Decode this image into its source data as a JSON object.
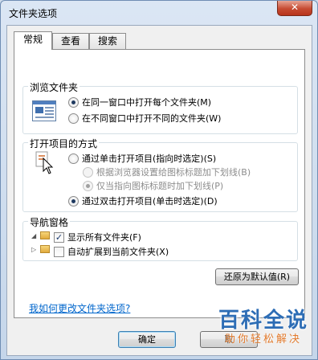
{
  "window": {
    "title": "文件夹选项",
    "close_label": "✕"
  },
  "tabs": [
    {
      "label": "常规",
      "active": true
    },
    {
      "label": "查看",
      "active": false
    },
    {
      "label": "搜索",
      "active": false
    }
  ],
  "browse_group": {
    "title": "浏览文件夹",
    "options": [
      {
        "label": "在同一窗口中打开每个文件夹(M)",
        "checked": true
      },
      {
        "label": "在不同窗口中打开不同的文件夹(W)",
        "checked": false
      }
    ]
  },
  "click_group": {
    "title": "打开项目的方式",
    "single_click": {
      "label": "通过单击打开项目(指向时选定)(S)",
      "checked": false
    },
    "underline_consistent": {
      "label": "根据浏览器设置给图标标题加下划线(B)",
      "checked": false
    },
    "underline_point": {
      "label": "仅当指向图标标题时加下划线(P)",
      "checked": true
    },
    "double_click": {
      "label": "通过双击打开项目(单击时选定)(D)",
      "checked": true
    }
  },
  "nav_group": {
    "title": "导航窗格",
    "show_all": {
      "label": "显示所有文件夹(F)",
      "checked": true,
      "mark": "✓"
    },
    "auto_expand": {
      "label": "自动扩展到当前文件夹(X)",
      "checked": false
    }
  },
  "restore_defaults_label": "还原为默认值(R)",
  "help_link": "我如何更改文件夹选项?",
  "ok_label": "确定",
  "cancel_label": "取",
  "watermark": {
    "main": "百科全说",
    "sub": "助你轻松解决"
  },
  "colors": {
    "link": "#0066cc",
    "close": "#c64b32",
    "watermark_blue": "#2d6db5",
    "watermark_orange": "#e27a2c"
  }
}
